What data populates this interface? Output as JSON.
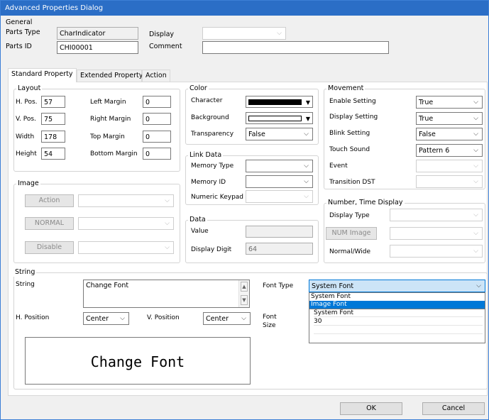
{
  "title": "Advanced Properties Dialog",
  "general": {
    "group_label": "General",
    "parts_type_label": "Parts Type",
    "parts_type_value": "CharIndicator",
    "display_label": "Display",
    "display_value": "",
    "parts_id_label": "Parts ID",
    "parts_id_value": "CHI00001",
    "comment_label": "Comment",
    "comment_value": ""
  },
  "tabs": [
    "Standard Property",
    "Extended Property",
    "Action"
  ],
  "layout": {
    "group_label": "Layout",
    "hpos_label": "H. Pos.",
    "hpos_value": "57",
    "vpos_label": "V. Pos.",
    "vpos_value": "75",
    "width_label": "Width",
    "width_value": "178",
    "height_label": "Height",
    "height_value": "54",
    "left_margin_label": "Left Margin",
    "left_margin_value": "0",
    "right_margin_label": "Right Margin",
    "right_margin_value": "0",
    "top_margin_label": "Top Margin",
    "top_margin_value": "0",
    "bottom_margin_label": "Bottom Margin",
    "bottom_margin_value": "0"
  },
  "color": {
    "group_label": "Color",
    "character_label": "Character",
    "character_color": "#000000",
    "background_label": "Background",
    "background_color": "#ffffff",
    "transparency_label": "Transparency",
    "transparency_value": "False"
  },
  "link_data": {
    "group_label": "Link Data",
    "memory_type_label": "Memory Type",
    "memory_type_value": "",
    "memory_id_label": "Memory ID",
    "memory_id_value": "",
    "numeric_keypad_label": "Numeric Keypad",
    "numeric_keypad_value": ""
  },
  "data": {
    "group_label": "Data",
    "value_label": "Value",
    "value_value": "",
    "display_digit_label": "Display Digit",
    "display_digit_value": "64"
  },
  "image": {
    "group_label": "Image",
    "action_button": "Action",
    "normal_button": "NORMAL",
    "disable_button": "Disable"
  },
  "movement": {
    "group_label": "Movement",
    "enable_setting_label": "Enable Setting",
    "enable_setting_value": "True",
    "display_setting_label": "Display Setting",
    "display_setting_value": "True",
    "blink_setting_label": "Blink Setting",
    "blink_setting_value": "False",
    "touch_sound_label": "Touch Sound",
    "touch_sound_value": "Pattern 6",
    "event_label": "Event",
    "event_value": "",
    "transition_dst_label": "Transition DST",
    "transition_dst_value": ""
  },
  "number_time": {
    "group_label": "Number, Time Display",
    "display_type_label": "Display Type",
    "display_type_value": "",
    "num_image_button": "NUM Image",
    "num_image_value": "",
    "normal_wide_label": "Normal/Wide",
    "normal_wide_value": ""
  },
  "string": {
    "group_label": "String",
    "string_label": "String",
    "string_value": "Change Font",
    "hpos_label": "H. Position",
    "hpos_value": "Center",
    "vpos_label": "V. Position",
    "vpos_value": "Center",
    "font_type_label": "Font Type",
    "font_type_value": "System Font",
    "font_type_options": [
      "System Font",
      "Image Font"
    ],
    "font_size_label": "Font\nSize",
    "font_list_name": "System Font",
    "font_list_size": "30",
    "preview_text": "Change Font"
  },
  "footer": {
    "ok_button": "OK",
    "cancel_button": "Cancel"
  }
}
